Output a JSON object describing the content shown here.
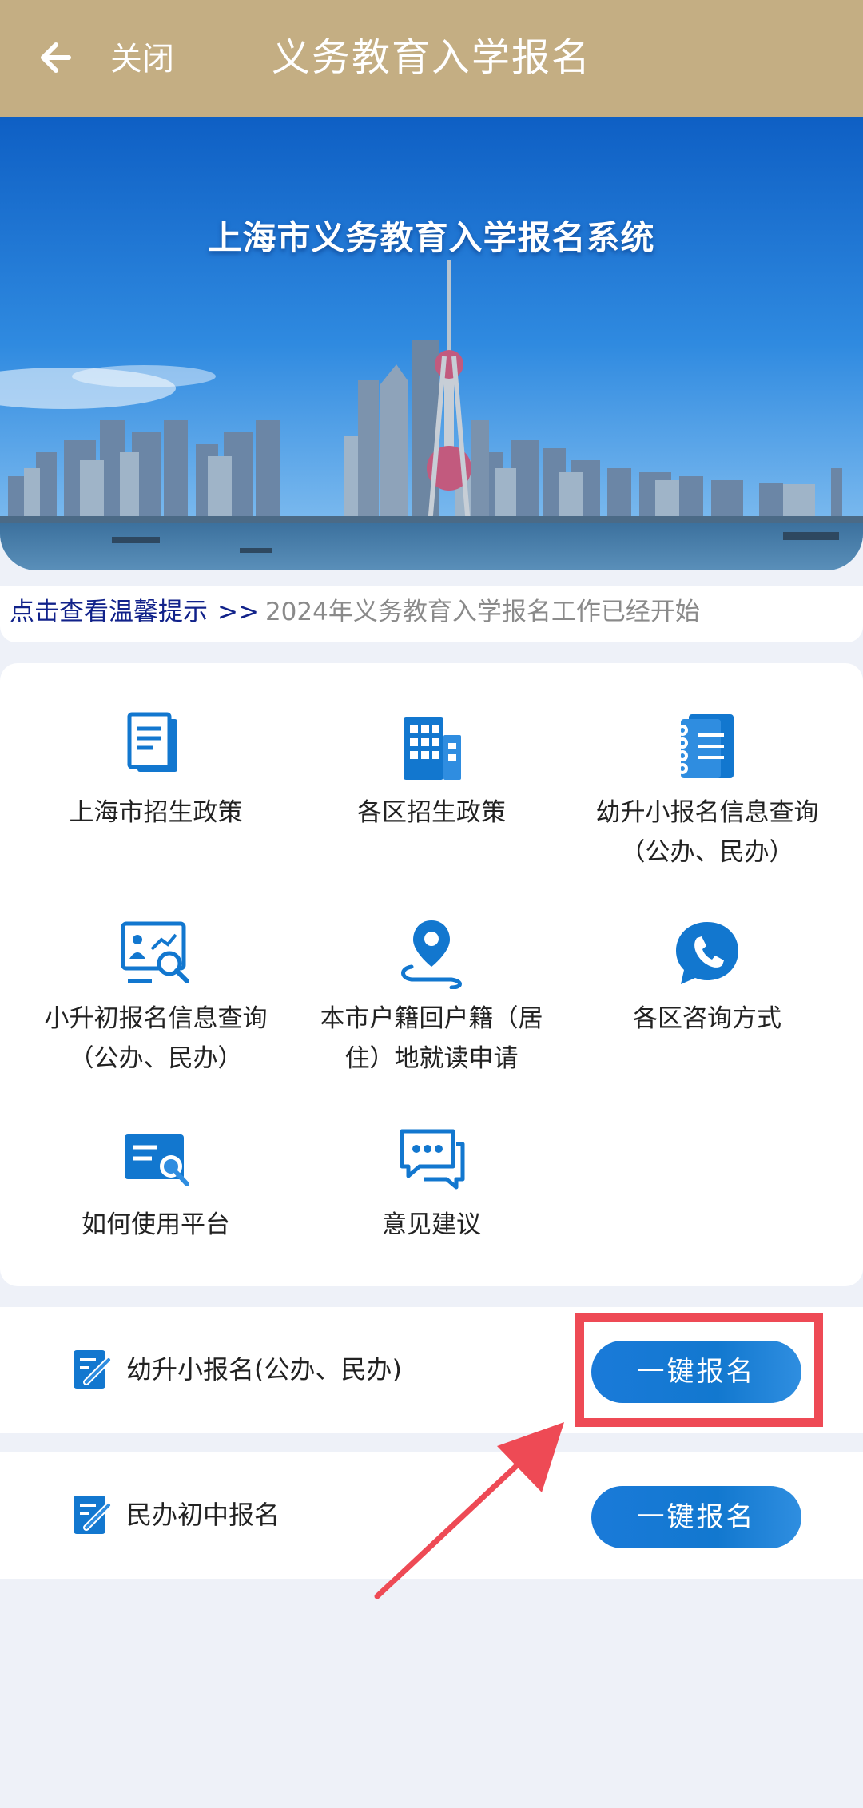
{
  "header": {
    "close_label": "关闭",
    "title": "义务教育入学报名"
  },
  "banner": {
    "title": "上海市义务教育入学报名系统"
  },
  "notice": {
    "link": "点击查看温馨提示",
    "arrow": ">>",
    "text": "2024年义务教育入学报名工作已经开始"
  },
  "grid": {
    "items": [
      {
        "icon": "document-icon",
        "label_line1": "上海市招生政策",
        "label_line2": ""
      },
      {
        "icon": "building-icon",
        "label_line1": "各区招生政策",
        "label_line2": ""
      },
      {
        "icon": "notebook-icon",
        "label_line1": "幼升小报名信息查询",
        "label_line2": "（公办、民办）"
      },
      {
        "icon": "search-profile-icon",
        "label_line1": "小升初报名信息查询",
        "label_line2": "（公办、民办）"
      },
      {
        "icon": "location-pin-icon",
        "label_line1": "本市户籍回户籍（居",
        "label_line2": "住）地就读申请"
      },
      {
        "icon": "phone-icon",
        "label_line1": "各区咨询方式",
        "label_line2": ""
      },
      {
        "icon": "card-settings-icon",
        "label_line1": "如何使用平台",
        "label_line2": ""
      },
      {
        "icon": "chat-bubble-icon",
        "label_line1": "意见建议",
        "label_line2": ""
      }
    ]
  },
  "registration": [
    {
      "label": "幼升小报名(公办、民办)",
      "button": "一键报名",
      "icon": "edit-icon"
    },
    {
      "label": "民办初中报名",
      "button": "一键报名",
      "icon": "edit-icon"
    }
  ],
  "colors": {
    "header_bg": "#c4ae83",
    "accent_blue": "#1278cf",
    "annotation_red": "#ee4a55",
    "notice_link": "#11228a"
  }
}
